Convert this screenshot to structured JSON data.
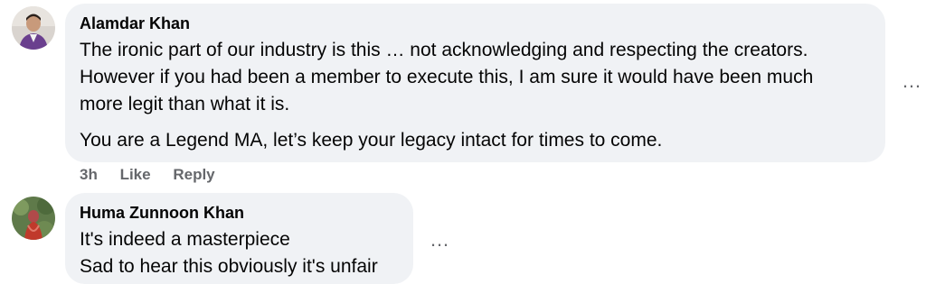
{
  "comments": [
    {
      "author": "Alamdar Khan",
      "lines": [
        "The ironic part of our industry is this … not acknowledging and respecting the creators.",
        "However if you had been a member to execute this, I am sure it would have been much",
        "more legit than what it is."
      ],
      "lines2": [
        "You are a Legend MA, let’s keep your legacy intact for times to come."
      ],
      "time": "3h",
      "like_label": "Like",
      "reply_label": "Reply",
      "more_label": "…"
    },
    {
      "author": "Huma Zunnoon Khan",
      "lines": [
        "It's indeed a masterpiece",
        "Sad to hear this obviously it's unfair"
      ],
      "more_label": "…"
    }
  ],
  "colors": {
    "bubble": "#f0f2f5",
    "secondary_text": "#65676b",
    "primary_text": "#050505"
  }
}
